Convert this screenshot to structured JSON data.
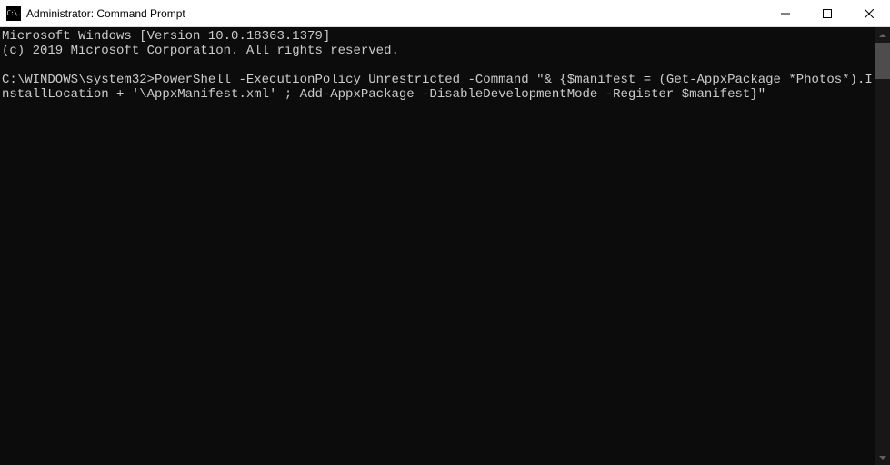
{
  "window": {
    "title": "Administrator: Command Prompt",
    "icon_text": "C:\\."
  },
  "terminal": {
    "line1": "Microsoft Windows [Version 10.0.18363.1379]",
    "line2": "(c) 2019 Microsoft Corporation. All rights reserved.",
    "blank": "",
    "prompt": "C:\\WINDOWS\\system32>",
    "command": "PowerShell -ExecutionPolicy Unrestricted -Command \"& {$manifest = (Get-AppxPackage *Photos*).InstallLocation + '\\AppxManifest.xml' ; Add-AppxPackage -DisableDevelopmentMode -Register $manifest}\""
  }
}
